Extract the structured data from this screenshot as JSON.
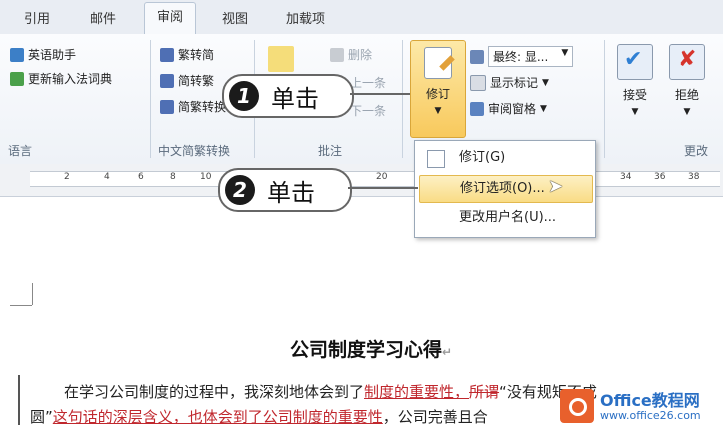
{
  "tabs": [
    "引用",
    "邮件",
    "审阅",
    "视图",
    "加载项"
  ],
  "ribbon": {
    "language": {
      "items": [
        "英语助手",
        "更新输入法词典"
      ],
      "label": "语言"
    },
    "chinese": {
      "items": [
        "繁转简",
        "简转繁",
        "简繁转换"
      ],
      "label": "中文简繁转换"
    },
    "comments": {
      "delete": "删除",
      "prev": "上一条",
      "next": "下一条",
      "label": "批注"
    },
    "tracking": {
      "revision_button": "修订",
      "final_display": "最终: 显...",
      "show_markup": "显示标记",
      "review_pane": "审阅窗格"
    },
    "changes": {
      "accept": "接受",
      "reject": "拒绝",
      "label": "更改"
    }
  },
  "ruler": [
    "2",
    "4",
    "6",
    "8",
    "10",
    "20",
    "34",
    "36",
    "38"
  ],
  "menu": {
    "items": [
      "修订(G)",
      "修订选项(O)...",
      "更改用户名(U)..."
    ]
  },
  "callouts": [
    {
      "num": "1",
      "text": "单击"
    },
    {
      "num": "2",
      "text": "单击"
    }
  ],
  "document": {
    "title": "公司制度学习心得",
    "para1_a": "在学习公司制度的过程中，我深刻地体会到了",
    "para1_ins": "制度的重要性，",
    "para1_del": "所谓",
    "para1_b": "“没有规矩不成",
    "para2_a": "圆”",
    "para2_ins": "这句话的深层含义，也体会到了公司制度的重要性",
    "para2_b": "，公司完善且合"
  },
  "logo": {
    "brand": "Office教程网",
    "url": "www.office26.com"
  },
  "colors": {
    "accent": "#f8c95c",
    "revision_red": "#c0272d"
  }
}
